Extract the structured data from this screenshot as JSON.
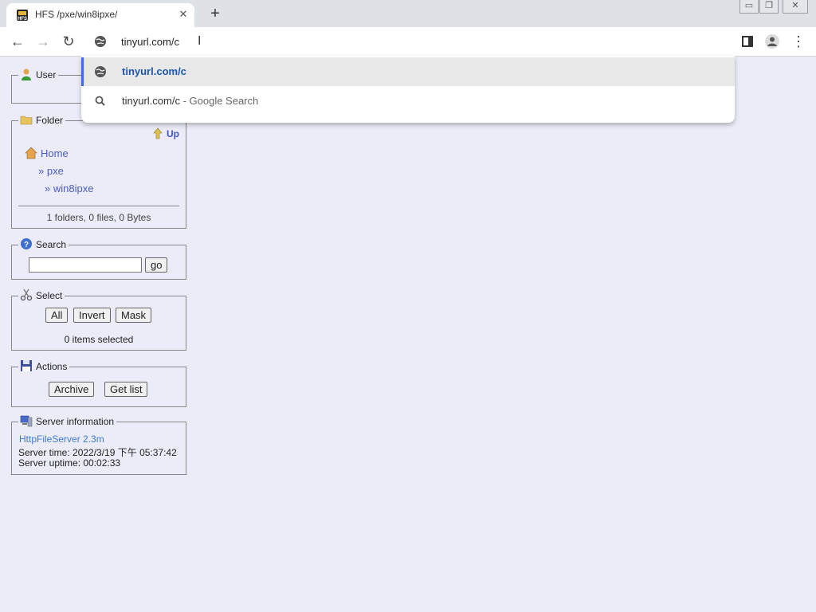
{
  "browser": {
    "tab_title": "HFS /pxe/win8ipxe/",
    "tab_close": "✕",
    "new_tab": "+",
    "win_min": "▭",
    "win_restore": "❐",
    "win_close": "✕",
    "back": "←",
    "forward": "→",
    "reload": "↻",
    "url_value": "tinyurl.com/c",
    "menu": "⋮"
  },
  "dropdown": {
    "suggestions": [
      {
        "text": "tinyurl.com/c",
        "icon": "globe-icon"
      },
      {
        "text": "tinyurl.com/c",
        "suffix": " - Google Search",
        "icon": "search-icon"
      }
    ]
  },
  "panels": {
    "user": {
      "title": "User"
    },
    "folder": {
      "title": "Folder",
      "up_label": "Up",
      "home": "Home",
      "pxe": "» pxe",
      "win8ipxe": "» win8ipxe",
      "stats": "1 folders, 0 files, 0 Bytes"
    },
    "search": {
      "title": "Search",
      "go_label": "go",
      "query": ""
    },
    "select": {
      "title": "Select",
      "all_label": "All",
      "invert_label": "Invert",
      "mask_label": "Mask",
      "selected_text": "0 items selected"
    },
    "actions": {
      "title": "Actions",
      "archive_label": "Archive",
      "getlist_label": "Get list"
    },
    "server": {
      "title": "Server information",
      "version": "HttpFileServer 2.3m",
      "time": "Server time: 2022/3/19 下午 05:37:42",
      "uptime": "Server uptime: 00:02:33"
    }
  }
}
